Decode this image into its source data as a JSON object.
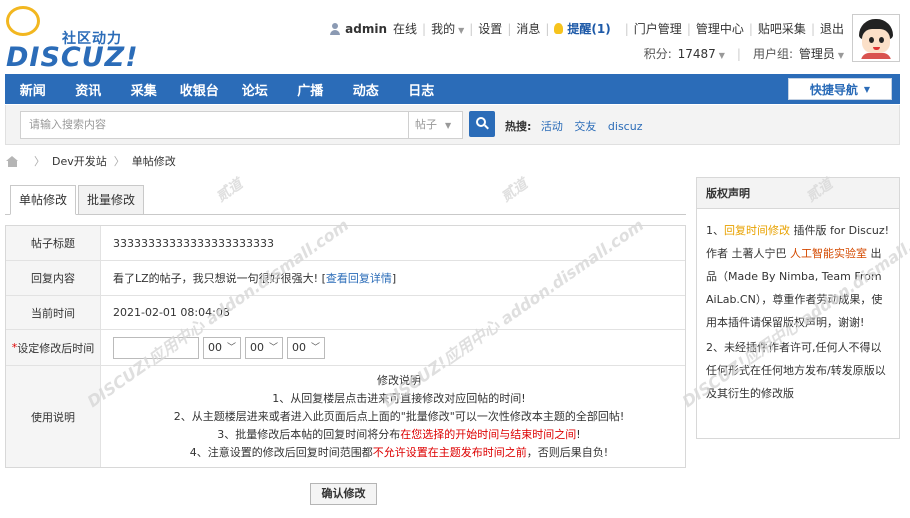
{
  "logo": {
    "cn_text": "社区动力",
    "en_text": "DISCUZ!"
  },
  "topbar": {
    "username": "admin",
    "status": "在线",
    "mine": "我的",
    "settings": "设置",
    "messages": "消息",
    "remind": "提醒(1)",
    "links": [
      "门户管理",
      "管理中心",
      "贴吧采集",
      "退出"
    ]
  },
  "topbar2": {
    "points_label": "积分:",
    "points_value": "17487",
    "group_label": "用户组:",
    "group_value": "管理员"
  },
  "nav": {
    "items": [
      "新闻",
      "资讯",
      "采集",
      "收银台",
      "论坛",
      "广播",
      "动态",
      "日志"
    ],
    "quick_nav": "快捷导航"
  },
  "search": {
    "placeholder": "请输入搜索内容",
    "type": "帖子",
    "hot_label": "热搜:",
    "hot_keywords": [
      "活动",
      "交友",
      "discuz"
    ]
  },
  "breadcrumb": [
    "Dev开发站",
    "单帖修改"
  ],
  "tabs": [
    "单帖修改",
    "批量修改"
  ],
  "form": {
    "title_label": "帖子标题",
    "title_value": "33333333333333333333333",
    "content_label": "回复内容",
    "content_text": "看了LZ的帖子，我只想说一句很好很强大! [",
    "content_link": "查看回复详情",
    "content_end": "]",
    "time_label": "当前时间",
    "time_value": "2021-02-01 08:04:08",
    "set_time_label": "设定修改后时间",
    "required_mark": "*",
    "hour": "00",
    "minute": "00",
    "second": "00",
    "usage_label": "使用说明",
    "usage_title": "修改说明",
    "usage_1": "1、从回复楼层点击进来可直接修改对应回帖的时间!",
    "usage_2": "2、从主题楼层进来或者进入此页面后点上面的\"批量修改\"可以一次性修改本主题的全部回帖!",
    "usage_3a": "3、批量修改后本帖的回复时间将分布",
    "usage_3b": "在您选择的开始时间与结束时间之间",
    "usage_3c": "!",
    "usage_4a": "4、注意设置的修改后回复时间范围都",
    "usage_4b": "不允许设置在主题发布时间之前",
    "usage_4c": "，否则后果自负!"
  },
  "submit": "确认修改",
  "sidebar": {
    "title": "版权声明",
    "p1a": "1、",
    "p1b": "回复时间修改",
    "p1c": " 插件版 for Discuz! 作者 土著人宁巴 ",
    "p1d": "人工智能实验室",
    "p1e": " 出品（Made By Nimba, Team From AiLab.CN），尊重作者劳动成果，使用本插件请保留版权声明，谢谢!",
    "p2": "2、未经插件作者许可,任何人不得以任何形式在任何地方发布/转发原版以及其衍生的修改版"
  },
  "watermark": {
    "text": "DISCUZ!应用中心 addon.dismall.com",
    "text2": "贰道"
  },
  "colors": {
    "brand": "#2b6cb8",
    "warning": "#d00000",
    "highlight": "#e8a200"
  }
}
